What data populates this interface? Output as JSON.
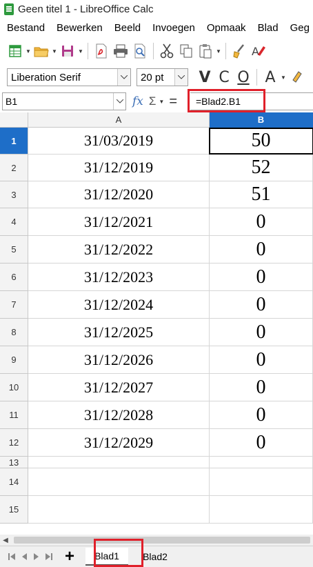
{
  "window": {
    "title": "Geen titel 1 - LibreOffice Calc"
  },
  "menu": [
    "Bestand",
    "Bewerken",
    "Beeld",
    "Invoegen",
    "Opmaak",
    "Blad",
    "Geg"
  ],
  "toolbar_icons": [
    "new-spreadsheet-icon",
    "open-folder-icon",
    "save-icon",
    "export-pdf-icon",
    "print-icon",
    "print-preview-icon",
    "cut-icon",
    "copy-icon",
    "paste-icon",
    "clone-formatting-icon",
    "clear-formatting-icon"
  ],
  "font": {
    "name": "Liberation Serif",
    "size": "20 pt"
  },
  "format_buttons": {
    "bold": "V",
    "italic": "C",
    "underline": "O",
    "font_color": "A"
  },
  "formula_bar": {
    "name_box": "B1",
    "fx_label": "fx",
    "sigma_label": "Σ",
    "equals_label": "=",
    "formula": "=Blad2.B1"
  },
  "columns": [
    "A",
    "B"
  ],
  "active_cell": {
    "column": "B",
    "row": 1
  },
  "rows": [
    {
      "num": "1",
      "a": "31/03/2019",
      "b": "50"
    },
    {
      "num": "2",
      "a": "31/12/2019",
      "b": "52"
    },
    {
      "num": "3",
      "a": "31/12/2020",
      "b": "51"
    },
    {
      "num": "4",
      "a": "31/12/2021",
      "b": "0"
    },
    {
      "num": "5",
      "a": "31/12/2022",
      "b": "0"
    },
    {
      "num": "6",
      "a": "31/12/2023",
      "b": "0"
    },
    {
      "num": "7",
      "a": "31/12/2024",
      "b": "0"
    },
    {
      "num": "8",
      "a": "31/12/2025",
      "b": "0"
    },
    {
      "num": "9",
      "a": "31/12/2026",
      "b": "0"
    },
    {
      "num": "10",
      "a": "31/12/2027",
      "b": "0"
    },
    {
      "num": "11",
      "a": "31/12/2028",
      "b": "0"
    },
    {
      "num": "12",
      "a": "31/12/2029",
      "b": "0"
    },
    {
      "num": "13",
      "a": "",
      "b": ""
    },
    {
      "num": "14",
      "a": "",
      "b": ""
    },
    {
      "num": "15",
      "a": "",
      "b": ""
    }
  ],
  "sheets": [
    {
      "name": "Blad1",
      "active": true
    },
    {
      "name": "Blad2",
      "active": false
    }
  ],
  "add_sheet_label": "+",
  "colors": {
    "highlight": "#e0202a",
    "accent": "#1e6ec8"
  }
}
